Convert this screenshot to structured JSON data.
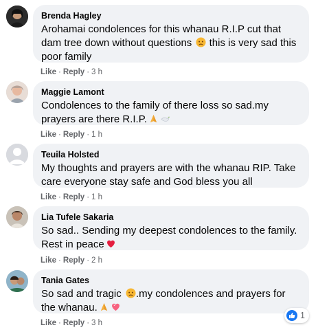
{
  "comments": [
    {
      "name": "Brenda Hagley",
      "text": "Arohamai condolences for this whanau R.I.P cut that dam tree down without questions",
      "text_after_emoji": " this is very sad this poor family",
      "emoji": "sad-face",
      "like_label": "Like",
      "reply_label": "Reply",
      "time": "3 h"
    },
    {
      "name": "Maggie Lamont",
      "text": "Condolences to the family of there loss so sad.my prayers are there R.I.P.",
      "emoji": "praying-hands-dove",
      "like_label": "Like",
      "reply_label": "Reply",
      "time": "1 h"
    },
    {
      "name": "Teuila Holsted",
      "text": "My thoughts and prayers are with the whanau RIP. Take care everyone stay safe and God bless you all",
      "like_label": "Like",
      "reply_label": "Reply",
      "time": "1 h"
    },
    {
      "name": "Lia Tufele Sakaria",
      "text": "So sad.. Sending my deepest condolences to the family. Rest in peace",
      "emoji": "red-heart",
      "like_label": "Like",
      "reply_label": "Reply",
      "time": "2 h"
    },
    {
      "name": "Tania Gates",
      "text": "So sad and tragic",
      "text_after_emoji": ".my condolences and prayers for the whanau.",
      "emoji": "sad-face-praying-hands-heart",
      "like_label": "Like",
      "reply_label": "Reply",
      "time": "3 h"
    }
  ],
  "reaction": {
    "count": "1",
    "icon": "like-thumb-icon"
  },
  "colors": {
    "bubble": "#f0f2f5",
    "meta": "#65676b",
    "like_blue": "#1877f2",
    "heart_red": "#e41e3f"
  }
}
